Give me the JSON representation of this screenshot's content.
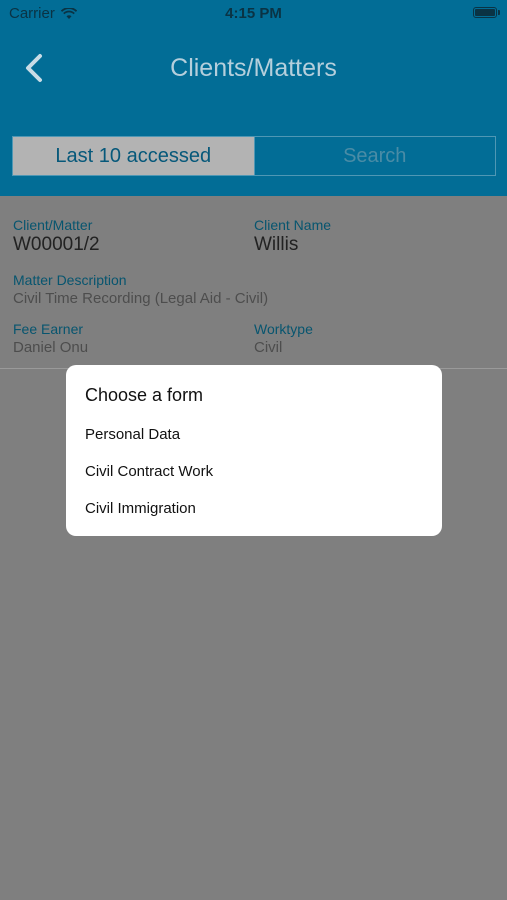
{
  "status": {
    "carrier": "Carrier",
    "time": "4:15 PM"
  },
  "nav": {
    "title": "Clients/Matters",
    "back_icon": "chevron-left-icon"
  },
  "segments": {
    "active": "Last 10 accessed",
    "inactive": "Search"
  },
  "record": {
    "client_matter_label": "Client/Matter",
    "client_matter_value": "W00001/2",
    "client_name_label": "Client Name",
    "client_name_value": "Willis",
    "matter_desc_label": "Matter Description",
    "matter_desc_value": "Civil Time Recording (Legal Aid - Civil)",
    "fee_earner_label": "Fee Earner",
    "fee_earner_value": "Daniel Onu",
    "worktype_label": "Worktype",
    "worktype_value": "Civil"
  },
  "dialog": {
    "title": "Choose a form",
    "options": [
      "Personal Data",
      "Civil Contract Work",
      "Civil Immigration"
    ]
  },
  "colors": {
    "header": "#026d96",
    "overlay": "#7f7f7f",
    "label": "#07556f"
  }
}
